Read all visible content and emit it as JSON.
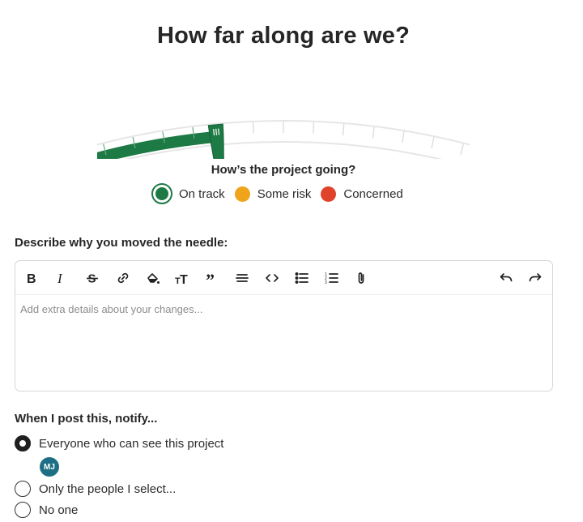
{
  "page": {
    "title": "How far along are we?"
  },
  "progress": {
    "fraction": 0.34
  },
  "status": {
    "question": "How’s the project going?",
    "selected": "on_track",
    "options": [
      {
        "key": "on_track",
        "label": "On track",
        "color": "#1d7a45"
      },
      {
        "key": "some_risk",
        "label": "Some risk",
        "color": "#f0a41c"
      },
      {
        "key": "concerned",
        "label": "Concerned",
        "color": "#e0432b"
      }
    ]
  },
  "describe": {
    "label": "Describe why you moved the needle:",
    "placeholder": "Add extra details about your changes..."
  },
  "toolbar": {
    "icons": [
      "bold-icon",
      "italic-icon",
      "strikethrough-icon",
      "link-icon",
      "highlight-icon",
      "text-size-icon",
      "quote-icon",
      "horizontal-rule-icon",
      "code-icon",
      "bullet-list-icon",
      "numbered-list-icon",
      "attachment-icon",
      "undo-icon",
      "redo-icon"
    ]
  },
  "notify": {
    "label": "When I post this, notify...",
    "options": [
      {
        "label": "Everyone who can see this project",
        "checked": true
      },
      {
        "label": "Only the people I select...",
        "checked": false
      },
      {
        "label": "No one",
        "checked": false
      }
    ],
    "avatar_initials": "MJ"
  },
  "colors": {
    "accent": "#1d7a45",
    "gauge_track": "#e6e6e6"
  }
}
